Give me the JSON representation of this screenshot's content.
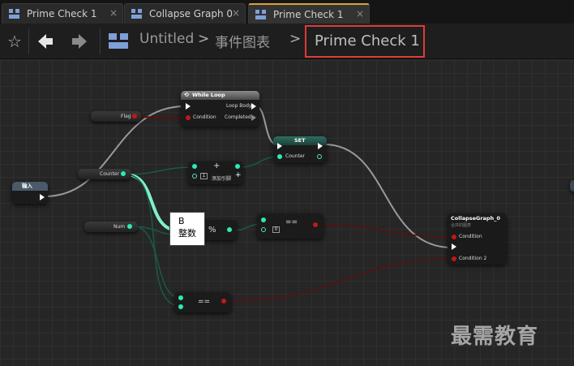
{
  "tabs": [
    {
      "label": "Prime Check 1",
      "close": "×"
    },
    {
      "label": "Collapse Graph 0",
      "close": "×"
    },
    {
      "label": "Prime Check 1",
      "close": "×"
    }
  ],
  "breadcrumb": {
    "star": "☆",
    "back": "🡄",
    "forward": "🡆",
    "items": [
      "Untitled",
      "事件图表"
    ],
    "separator": ">",
    "current": "Prime Check 1"
  },
  "nodes": {
    "while_loop": {
      "title": "While Loop",
      "in_exec": "",
      "condition": "Condition",
      "loop_body": "Loop Body",
      "completed": "Completed"
    },
    "flag": {
      "label": "Flag"
    },
    "counter_get": {
      "label": "Counter"
    },
    "input": {
      "label": "输入"
    },
    "add": {
      "symbol": "+",
      "value": "1",
      "add_pin": "添加引脚"
    },
    "set": {
      "title": "SET",
      "var": "Counter"
    },
    "num": {
      "label": "Num"
    },
    "mod": {
      "symbol": "%"
    },
    "eq_top": {
      "symbol": "==",
      "value": "0"
    },
    "eq_bottom": {
      "symbol": "=="
    },
    "collapse": {
      "title": "CollapseGraph_0",
      "subtitle": "合并的图表",
      "condition": "Condition",
      "condition2": "Condition 2"
    }
  },
  "tooltip": {
    "line1": "B",
    "line2": "整数"
  },
  "watermark": "最需教育",
  "colors": {
    "exec": "#ffffff",
    "bool": "#8b0000",
    "int": "#1fe0a8",
    "highlight": "#e03a3a"
  }
}
